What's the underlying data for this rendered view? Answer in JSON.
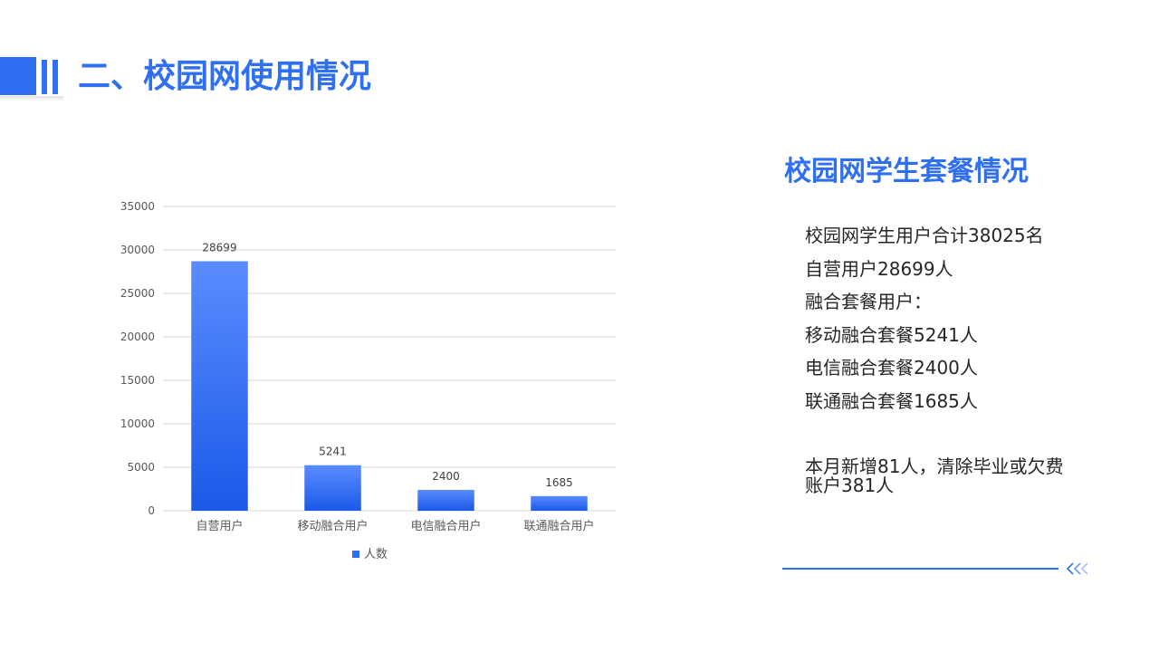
{
  "header": {
    "title": "二、校园网使用情况"
  },
  "side_panel": {
    "title": "校园网学生套餐情况",
    "lines": [
      "校园网学生用户合计38025名",
      "自营用户28699人",
      "融合套餐用户：",
      "移动融合套餐5241人",
      "电信融合套餐2400人",
      "联通融合套餐1685人"
    ],
    "note": "本月新增81人，清除毕业或欠费账户381人"
  },
  "colors": {
    "accent": "#2f6ff1",
    "bar_top": "#5a8cff",
    "bar_bottom": "#1a5ae8"
  },
  "chart_data": {
    "type": "bar",
    "categories": [
      "自营用户",
      "移动融合用户",
      "电信融合用户",
      "联通融合用户"
    ],
    "series": [
      {
        "name": "人数",
        "values": [
          28699,
          5241,
          2400,
          1685
        ]
      }
    ],
    "ylim": [
      0,
      35000
    ],
    "yticks": [
      0,
      5000,
      10000,
      15000,
      20000,
      25000,
      30000,
      35000
    ],
    "grid": true,
    "legend": "bottom"
  }
}
